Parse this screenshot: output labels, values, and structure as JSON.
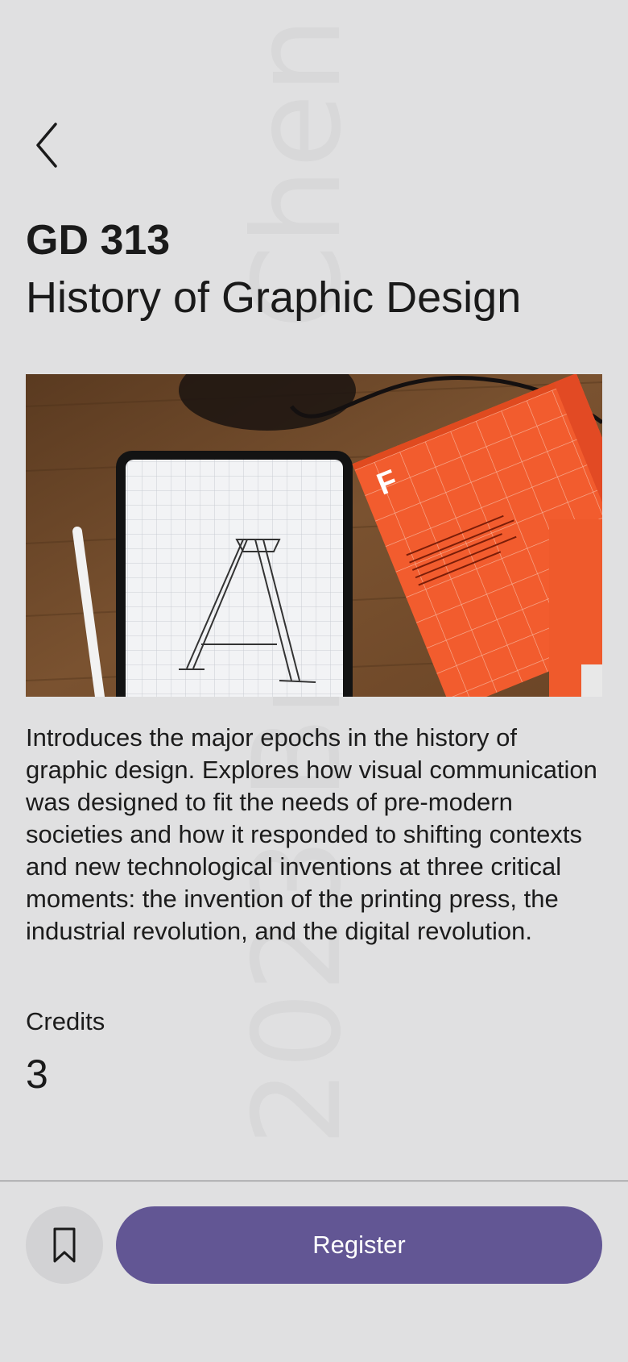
{
  "nav": {
    "back_icon": "chevron-left-icon"
  },
  "course": {
    "code": "GD 313",
    "title": "History of Graphic Design",
    "image_alt": "Tablet with letter A sketch beside an orange design book",
    "description": "Introduces the major epochs in the history of graphic design. Explores how visual communication was designed to fit the needs of pre-modern societies and how it responded to shifting contexts and new technological inventions at three critical moments: the invention of the printing press, the industrial revolution, and the digital revolution.",
    "credits_label": "Credits",
    "credits_value": "3"
  },
  "watermark": "© 2023 Brenda Chen",
  "actions": {
    "bookmark_icon": "bookmark-icon",
    "register_label": "Register"
  },
  "colors": {
    "background": "#e0e0e1",
    "accent": "#625694",
    "bookmark_bg": "#d2d2d4",
    "text": "#1c1c1c"
  }
}
